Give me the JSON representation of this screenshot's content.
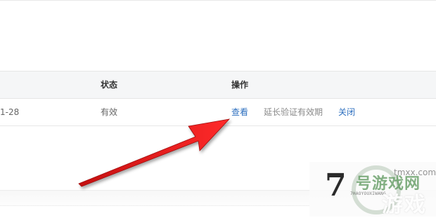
{
  "table": {
    "headers": {
      "status": "状态",
      "action": "操作"
    },
    "rows": [
      {
        "date": "1-28",
        "status": "有效",
        "actions": {
          "view": "查看",
          "extend": "延长验证有效期",
          "close": "关闭"
        }
      }
    ]
  },
  "annotation": {
    "arrow_color": "#e8191a",
    "points_to": "view"
  },
  "watermark": {
    "logo_number": "7",
    "brand_line1": "号游戏网",
    "brand_pinyin": "7HAOYOUXIWANG",
    "domain": "tmxx.com",
    "brand_line2": "游戏"
  },
  "colors": {
    "link": "#2d6fbf",
    "muted_link": "#8a8a8a",
    "header_bg": "#f5f6f7"
  }
}
